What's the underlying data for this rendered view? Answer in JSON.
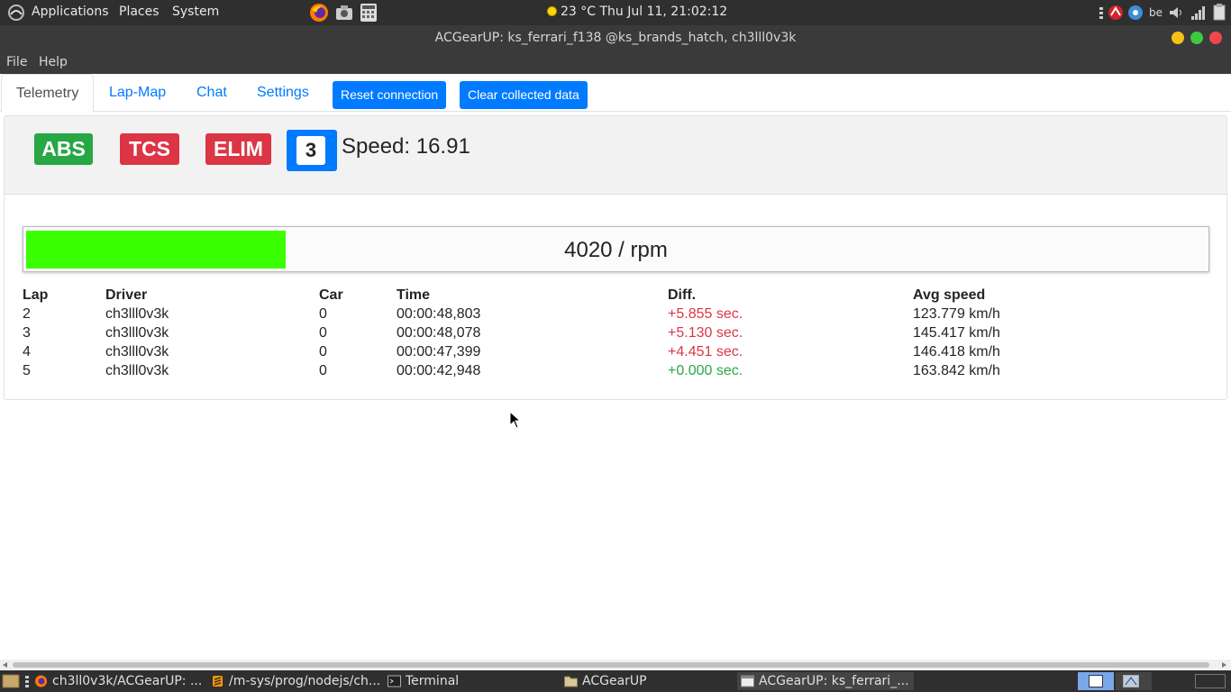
{
  "top_panel": {
    "menus": [
      "Applications",
      "Places",
      "System"
    ],
    "launchers": [
      "firefox-icon",
      "screenshot-icon",
      "calculator-icon"
    ],
    "weather_temp": "23 °C",
    "clock": "Thu Jul 11, 21:02:12",
    "keyboard_layout": "be"
  },
  "window": {
    "title": "ACGearUP: ks_ferrari_f138 @ks_brands_hatch, ch3lll0v3k",
    "controls": [
      "minimize",
      "maximize",
      "close"
    ]
  },
  "menubar": {
    "file": "File",
    "help": "Help"
  },
  "nav": {
    "tabs": [
      "Telemetry",
      "Lap-Map",
      "Chat",
      "Settings"
    ],
    "active_tab": "Telemetry",
    "reset_button": "Reset connection",
    "clear_button": "Clear collected data"
  },
  "telemetry": {
    "badges": [
      {
        "label": "ABS",
        "color": "#28a745"
      },
      {
        "label": "TCS",
        "color": "#dc3545"
      },
      {
        "label": "ELIM",
        "color": "#dc3545"
      }
    ],
    "gear": "3",
    "speed_text": "Speed: 16.91",
    "rpm_text": "4020 / rpm",
    "rpm_fill_fraction": 0.22,
    "rpm_color": "#39ff00"
  },
  "laps": {
    "headers": [
      "Lap",
      "Driver",
      "Car",
      "Time",
      "Diff.",
      "Avg speed"
    ],
    "rows": [
      {
        "lap": "2",
        "driver": "ch3lll0v3k",
        "car": "0",
        "time": "00:00:48,803",
        "diff": "+5.855 sec.",
        "avg": "123.779 km/h"
      },
      {
        "lap": "3",
        "driver": "ch3lll0v3k",
        "car": "0",
        "time": "00:00:48,078",
        "diff": "+5.130 sec.",
        "avg": "145.417 km/h"
      },
      {
        "lap": "4",
        "driver": "ch3lll0v3k",
        "car": "0",
        "time": "00:00:47,399",
        "diff": "+4.451 sec.",
        "avg": "146.418 km/h"
      },
      {
        "lap": "5",
        "driver": "ch3lll0v3k",
        "car": "0",
        "time": "00:00:42,948",
        "diff": "+0.000 sec.",
        "avg": "163.842 km/h"
      }
    ]
  },
  "taskbar": {
    "tasks": [
      {
        "label": "ch3ll0v3k/ACGearUP: ...",
        "icon": "firefox-icon"
      },
      {
        "label": "/m-sys/prog/nodejs/ch...",
        "icon": "sublime-icon"
      },
      {
        "label": "Terminal",
        "icon": "terminal-icon"
      },
      {
        "label": "ACGearUP",
        "icon": "folder-icon"
      },
      {
        "label": "ACGearUP: ks_ferrari_...",
        "icon": "window-icon"
      }
    ]
  }
}
